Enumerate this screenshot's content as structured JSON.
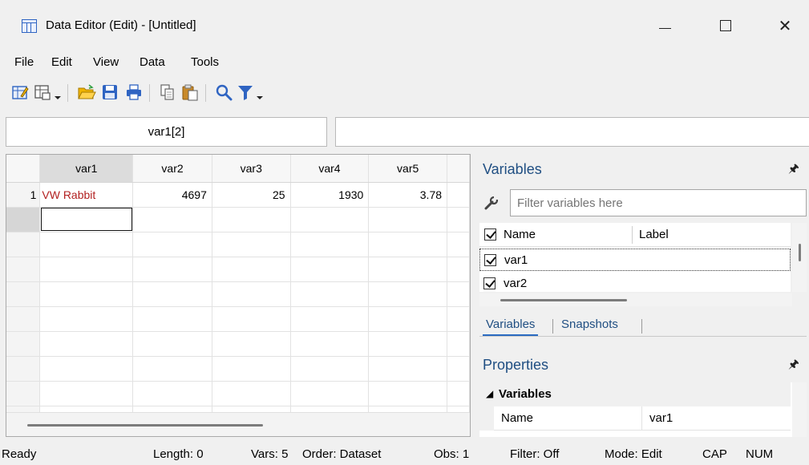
{
  "window": {
    "title": "Data Editor (Edit) - [Untitled]",
    "controls": {
      "minimize": "minimize",
      "maximize": "maximize",
      "close": "✕"
    }
  },
  "menu": [
    "File",
    "Edit",
    "View",
    "Data",
    "Tools"
  ],
  "toolbar": {
    "icons": [
      "edit-mode-icon",
      "browse-mode-icon",
      "dropdown-arrow-icon",
      "open-folder-icon",
      "save-icon",
      "print-icon",
      "copy-icon",
      "paste-icon",
      "search-icon",
      "filter-icon",
      "dropdown-arrow-icon"
    ]
  },
  "cell_name": "var1[2]",
  "cell_value": "",
  "grid": {
    "columns": [
      "var1",
      "var2",
      "var3",
      "var4",
      "var5"
    ],
    "active_column": "var1",
    "rows": [
      {
        "index": "1",
        "cells": [
          "VW Rabbit",
          "4697",
          "25",
          "1930",
          "3.78"
        ]
      }
    ],
    "selected_cell": {
      "row": 2,
      "column": "var1"
    }
  },
  "variables_panel": {
    "title": "Variables",
    "pin_icon": "pin-icon",
    "filter_placeholder": "Filter variables here",
    "header": {
      "name": "Name",
      "label": "Label"
    },
    "items": [
      {
        "name": "var1",
        "checked": true
      },
      {
        "name": "var2",
        "checked": true
      }
    ]
  },
  "tabs": [
    {
      "label": "Variables",
      "active": true
    },
    {
      "label": "Snapshots",
      "active": false
    }
  ],
  "properties_panel": {
    "title": "Properties",
    "pin_icon": "pin-icon",
    "group": "Variables",
    "rows": [
      {
        "key": "Name",
        "value": "var1"
      }
    ]
  },
  "status": {
    "ready": "Ready",
    "length": "Length: 0",
    "vars": "Vars: 5",
    "order": "Order: Dataset",
    "obs": "Obs: 1",
    "filter": "Filter: Off",
    "mode": "Mode: Edit",
    "cap": "CAP",
    "num": "NUM"
  },
  "colors": {
    "string_value": "#b21f1f",
    "panel_title": "#1f4e82",
    "tab_underline": "#2a6bc1"
  }
}
